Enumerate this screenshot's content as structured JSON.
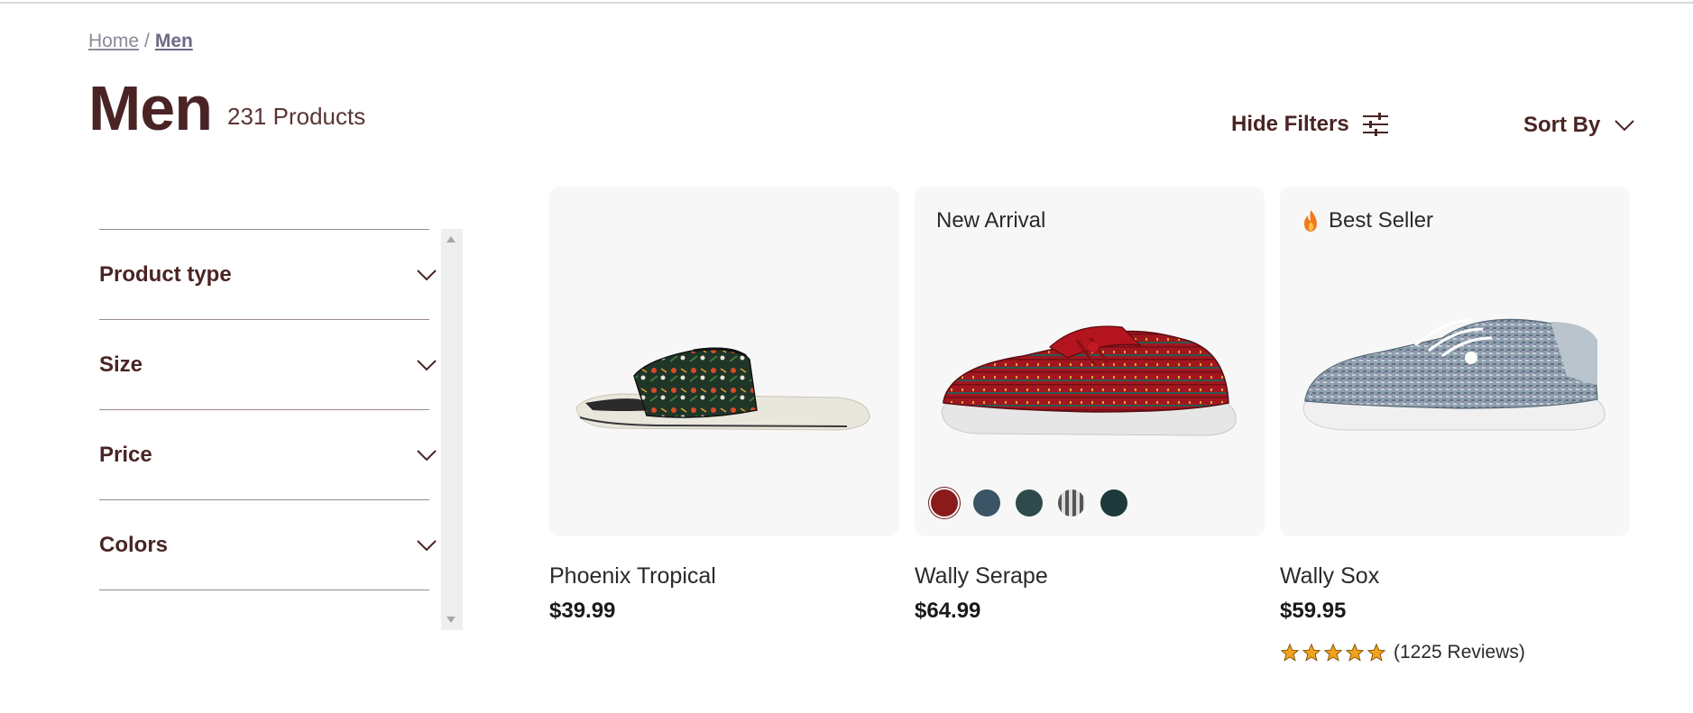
{
  "breadcrumb": {
    "home": "Home",
    "separator": "/",
    "current": "Men"
  },
  "page": {
    "title": "Men",
    "count": "231 Products"
  },
  "toolbar": {
    "hide_filters": "Hide Filters",
    "sort_by": "Sort By"
  },
  "filters": [
    {
      "label": "Product type"
    },
    {
      "label": "Size"
    },
    {
      "label": "Price"
    },
    {
      "label": "Colors"
    }
  ],
  "products": [
    {
      "name": "Phoenix Tropical",
      "price": "$39.99",
      "badge": ""
    },
    {
      "name": "Wally Serape",
      "price": "$64.99",
      "badge": "New Arrival",
      "swatch_colors": [
        "#8b1a1a",
        "#3b5466",
        "#2f4a4a",
        "#8c8c8c",
        "#1f3a3a"
      ]
    },
    {
      "name": "Wally Sox",
      "price": "$59.95",
      "badge": "Best Seller",
      "rating": {
        "stars": 5,
        "reviews": "(1225 Reviews)"
      }
    }
  ],
  "colors": {
    "brand": "#4a2424",
    "star": "#f2a31b",
    "flame": "#f07a1a"
  },
  "icons": {
    "filters": "sliders-icon",
    "sort": "chevron-down-icon",
    "badge": "flame-icon",
    "rating": "star-icon"
  }
}
